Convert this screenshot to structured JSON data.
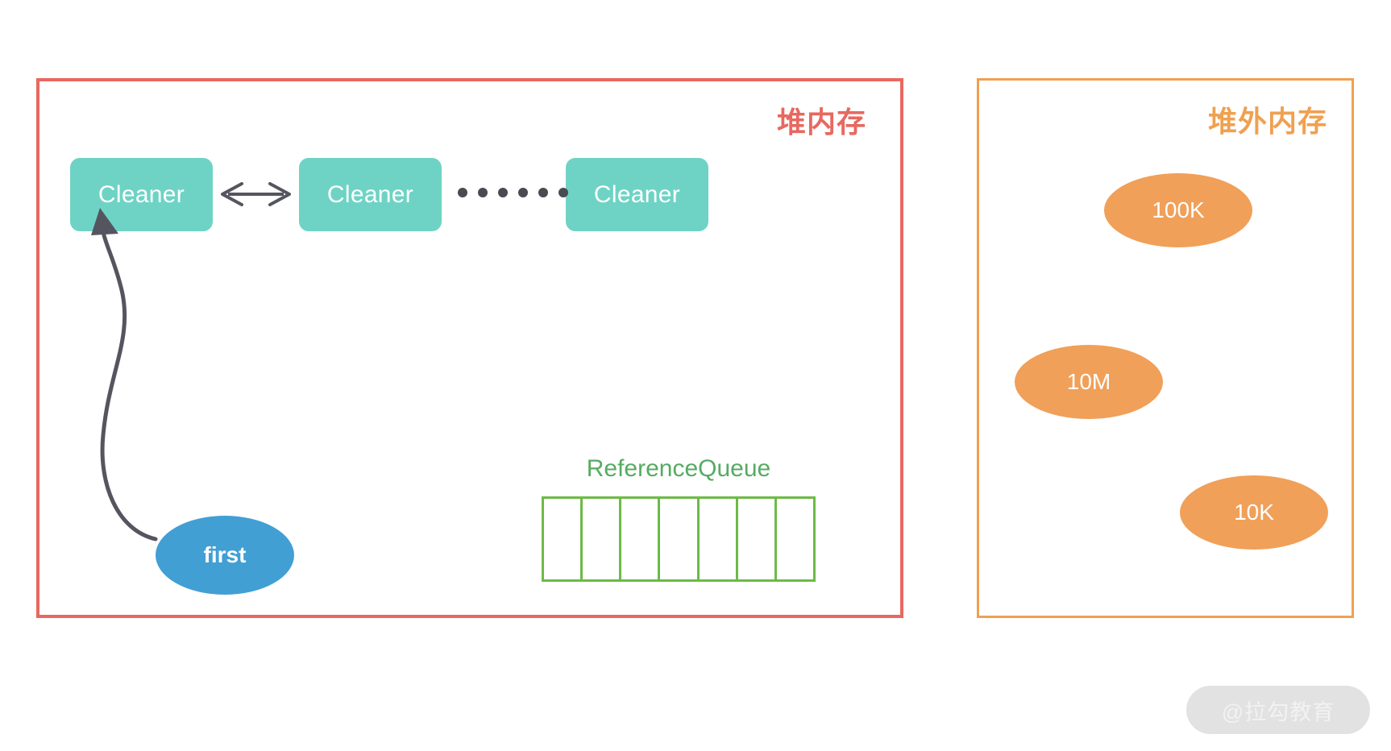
{
  "diagram": {
    "title": "Java Cleaner / ReferenceQueue and off-heap memory diagram",
    "colors": {
      "heap_border": "#e8685f",
      "heap_label": "#e8685f",
      "offheap_border": "#f0a050",
      "offheap_label": "#f0a050",
      "cleaner_fill": "#6ed3c5",
      "first_fill": "#419fd4",
      "offheap_object_fill": "#f0a059",
      "queue_border": "#6cbb45",
      "queue_title": "#56ab63",
      "arrow_stroke": "#55555f",
      "dot_fill": "#4a4a52",
      "watermark_bg": "#e2e2e2",
      "watermark_text": "#f2f2f2"
    }
  },
  "heap_panel": {
    "label": "堆内存",
    "cleaners": [
      {
        "label": "Cleaner"
      },
      {
        "label": "Cleaner"
      },
      {
        "label": "Cleaner"
      }
    ],
    "ellipsis": {
      "name": "ellipsis-dots",
      "dot_count": 6
    },
    "link_arrow": {
      "name": "double-headed-arrow",
      "direction": "both"
    },
    "first_reference": {
      "label": "first"
    },
    "first_arrow": {
      "name": "curved-arrow-first-to-cleaner",
      "direction": "up"
    },
    "reference_queue": {
      "title": "ReferenceQueue",
      "cells": [
        "",
        "",
        "",
        "",
        "",
        "",
        ""
      ]
    }
  },
  "offheap_panel": {
    "label": "堆外内存",
    "objects": [
      {
        "label": "100K"
      },
      {
        "label": "10M"
      },
      {
        "label": "10K"
      }
    ]
  },
  "watermark": {
    "text": "@拉勾教育"
  }
}
